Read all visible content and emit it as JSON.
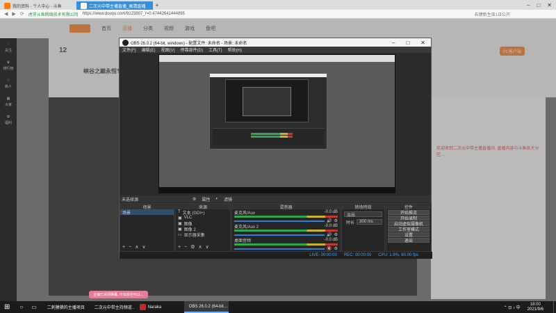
{
  "browser": {
    "tabs": [
      {
        "label": "我的资料 - 个人中心 - 斗鱼"
      },
      {
        "label": "二次元中带主播直播_高清直播"
      }
    ],
    "new_tab": "+",
    "url_prefix": "虎牙斗鱼网络技术有限公司",
    "url": "https://www.douyu.com/9123807_r=0.47442641444895",
    "search_hint": "右键新生虫1日公开"
  },
  "site": {
    "nav": [
      "首页",
      "直播",
      "分类",
      "视频",
      "游戏",
      "鱼吧"
    ],
    "fans_count": "12",
    "room_title": "峡谷之巅永恒专区",
    "left_items": [
      "关注",
      "排行榜",
      "新人",
      "大家",
      "福利"
    ],
    "pc_client": "PC客户端",
    "chat_hint": "主播已关闭弹幕, 只有粉丝可以…",
    "right_text": "欢迎来到二次元中带主播直播间, 直播内容与斗鱼各大分区…"
  },
  "obs": {
    "title": "OBS 26.0.2 (64-bit, windows) - 配置文件: 未命名 - 场景: 未命名",
    "menu": [
      "文件(F)",
      "编辑(E)",
      "视图(V)",
      "停靠部件(D)",
      "工具(T)",
      "帮助(H)"
    ],
    "source_bar": "未选择源",
    "properties": "属性",
    "filters": "滤镜",
    "docks": {
      "scenes": {
        "title": "场景",
        "items": [
          "场景"
        ]
      },
      "sources": {
        "title": "来源",
        "items": [
          "文本 (GDI+)",
          "VLC",
          "图像",
          "图像 2",
          "显示器采集"
        ]
      },
      "mixer": {
        "title": "混音器",
        "channels": [
          {
            "name": "麦克风/Aux",
            "db": "-0.0 dB"
          },
          {
            "name": "麦克风/Aux 2",
            "db": "-0.0 dB"
          },
          {
            "name": "桌面音频",
            "db": "-0.0 dB"
          }
        ]
      },
      "transitions": {
        "title": "转场特效",
        "type": "淡出",
        "duration_label": "时长",
        "duration": "300 ms"
      },
      "controls": {
        "title": "控件",
        "buttons": [
          "开始推流",
          "开始录制",
          "启动虚拟摄像机",
          "工作室模式",
          "设置",
          "退出"
        ]
      }
    },
    "status": {
      "live": "LIVE: 00:00:00",
      "rec": "REC: 00:00:00",
      "cpu": "CPU: 1.9%, 60.00 fps"
    }
  },
  "taskbar": {
    "start": "⊞",
    "apps": [
      "二刺猿狒的主播项目",
      "二次元中带主持频道…",
      "Naraka",
      "OBS 26.0.2 (64-bit…"
    ],
    "active_index": 3,
    "time": "18:00",
    "date": "2021/9/6"
  },
  "colors": {
    "accent": "#3a8fd9",
    "douyu_orange": "#ff7a18",
    "obs_bg": "#2b2b2b",
    "mute_red": "#c93434"
  }
}
